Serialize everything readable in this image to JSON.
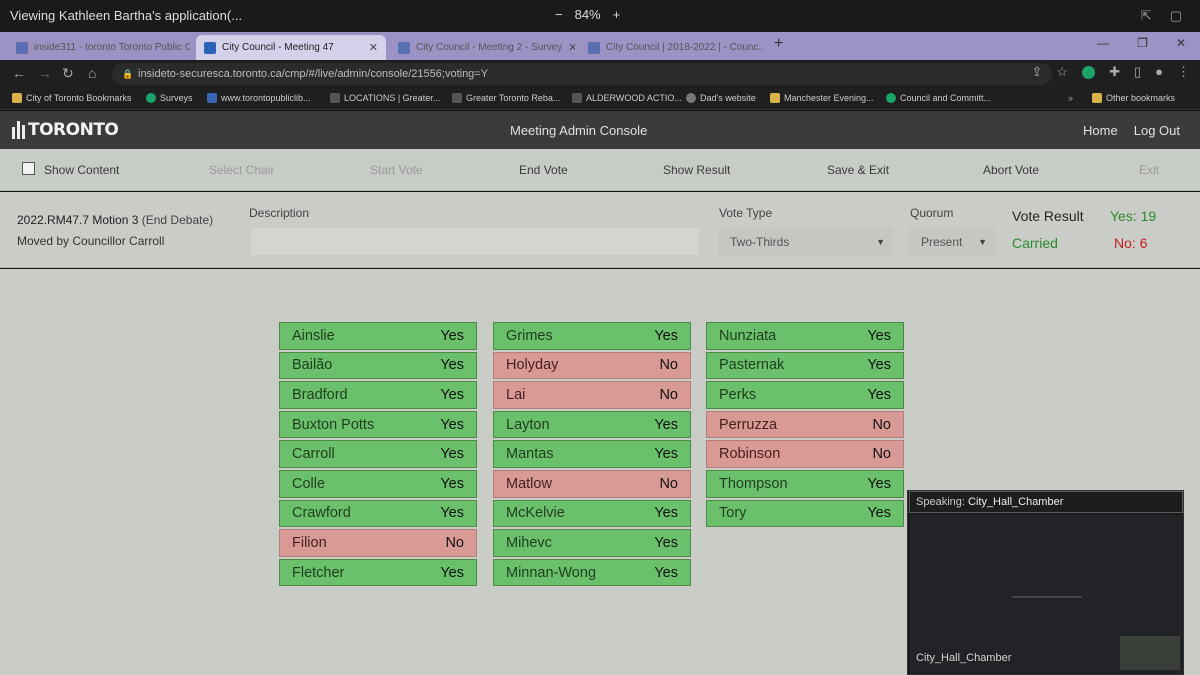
{
  "share": {
    "title": "Viewing Kathleen Bartha's application(...",
    "zoom_out": "−",
    "zoom_level": "84%",
    "zoom_in": "+"
  },
  "browser": {
    "tabs": [
      {
        "label": "inside311 - toronto Toronto Public C..."
      },
      {
        "label": "City Council - Meeting 47"
      },
      {
        "label": "City Council - Meeting 2 - Survey"
      },
      {
        "label": "City Council | 2018-2022 | - Counc..."
      }
    ],
    "url": "insideto-securesca.toronto.ca/cmp/#/live/admin/console/21556;voting=Y",
    "bookmarks": [
      "City of Toronto Bookmarks",
      "Surveys",
      "www.torontopubliclib...",
      "LOCATIONS | Greater...",
      "Greater Toronto Reba...",
      "ALDERWOOD ACTIO...",
      "Dad's website",
      "Manchester Evening...",
      "Council and Committ...",
      "Other bookmarks"
    ]
  },
  "header": {
    "logo_text": "TORONTO",
    "title": "Meeting Admin Console",
    "home": "Home",
    "logout": "Log Out"
  },
  "actions": {
    "show_content": "Show Content",
    "select_chair": "Select Chair",
    "start_vote": "Start Vote",
    "end_vote": "End Vote",
    "show_result": "Show Result",
    "save_exit": "Save & Exit",
    "abort_vote": "Abort Vote",
    "exit": "Exit"
  },
  "motion": {
    "id": "2022.RM47.7 Motion 3",
    "qualifier": "(End Debate)",
    "moved_by": "Moved by Councillor Carroll",
    "description_label": "Description",
    "description_value": "",
    "vote_type_label": "Vote Type",
    "vote_type_value": "Two-Thirds",
    "quorum_label": "Quorum",
    "quorum_value": "Present",
    "result_label": "Vote Result",
    "result_value": "Carried",
    "yes_count": "Yes: 19",
    "no_count": "No: 6"
  },
  "votes": [
    [
      {
        "name": "Ainslie",
        "vote": "Yes"
      },
      {
        "name": "Bailão",
        "vote": "Yes"
      },
      {
        "name": "Bradford",
        "vote": "Yes"
      },
      {
        "name": "Buxton Potts",
        "vote": "Yes"
      },
      {
        "name": "Carroll",
        "vote": "Yes"
      },
      {
        "name": "Colle",
        "vote": "Yes"
      },
      {
        "name": "Crawford",
        "vote": "Yes"
      },
      {
        "name": "Filion",
        "vote": "No"
      },
      {
        "name": "Fletcher",
        "vote": "Yes"
      }
    ],
    [
      {
        "name": "Grimes",
        "vote": "Yes"
      },
      {
        "name": "Holyday",
        "vote": "No"
      },
      {
        "name": "Lai",
        "vote": "No"
      },
      {
        "name": "Layton",
        "vote": "Yes"
      },
      {
        "name": "Mantas",
        "vote": "Yes"
      },
      {
        "name": "Matlow",
        "vote": "No"
      },
      {
        "name": "McKelvie",
        "vote": "Yes"
      },
      {
        "name": "Mihevc",
        "vote": "Yes"
      },
      {
        "name": "Minnan-Wong",
        "vote": "Yes"
      }
    ],
    [
      {
        "name": "Nunziata",
        "vote": "Yes"
      },
      {
        "name": "Pasternak",
        "vote": "Yes"
      },
      {
        "name": "Perks",
        "vote": "Yes"
      },
      {
        "name": "Perruzza",
        "vote": "No"
      },
      {
        "name": "Robinson",
        "vote": "No"
      },
      {
        "name": "Thompson",
        "vote": "Yes"
      },
      {
        "name": "Tory",
        "vote": "Yes"
      }
    ]
  ],
  "speaker": {
    "label": "Speaking:",
    "name": "City_Hall_Chamber",
    "video_name": "City_Hall_Chamber"
  },
  "colors": {
    "yes_bg": "#6bc16b",
    "no_bg": "#d99a95",
    "carried": "#2f8a2f",
    "no_text": "#c42020"
  }
}
